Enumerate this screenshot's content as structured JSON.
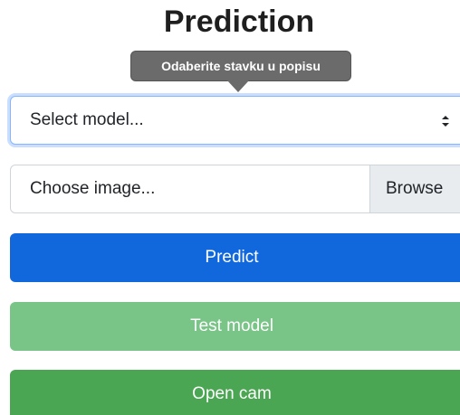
{
  "header": {
    "title": "Prediction"
  },
  "tooltip": {
    "text": "Odaberite stavku u popisu"
  },
  "model_select": {
    "selected_value": "Select model...",
    "arrow_glyph": "↕"
  },
  "image_input": {
    "placeholder": "Choose image...",
    "browse_label": "Browse"
  },
  "buttons": {
    "predict_label": "Predict",
    "test_model_label": "Test model",
    "open_cam_label": "Open cam"
  },
  "colors": {
    "predict": "#1168dc",
    "test_model": "#79c487",
    "open_cam": "#4ba653",
    "tooltip": "#6b6b6b",
    "focus_ring": "#86b7fe"
  }
}
